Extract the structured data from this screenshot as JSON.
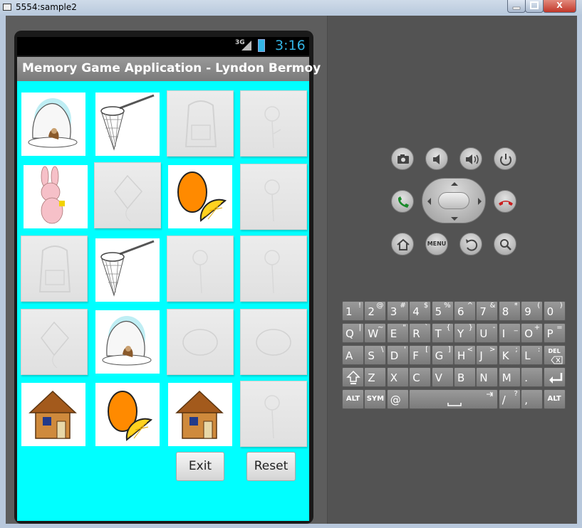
{
  "window": {
    "title": "5554:sample2",
    "close_glyph": "X"
  },
  "status": {
    "network": "3G",
    "time": "3:16"
  },
  "app": {
    "title": "Memory Game Application - Lyndon Bermoy"
  },
  "buttons": {
    "exit": "Exit",
    "reset": "Reset"
  },
  "hardware": {
    "menu": "MENU"
  },
  "cards": [
    {
      "state": "face-up",
      "image": "igloo"
    },
    {
      "state": "face-up",
      "image": "butterfly-net"
    },
    {
      "state": "face-down",
      "image": "backpack"
    },
    {
      "state": "face-down",
      "image": "flower"
    },
    {
      "state": "face-up",
      "image": "bunny"
    },
    {
      "state": "face-down",
      "image": "kite"
    },
    {
      "state": "face-up",
      "image": "orange"
    },
    {
      "state": "face-down",
      "image": "flower"
    },
    {
      "state": "face-down",
      "image": "backpack"
    },
    {
      "state": "face-up",
      "image": "butterfly-net"
    },
    {
      "state": "face-down",
      "image": "flower"
    },
    {
      "state": "face-down",
      "image": "flower"
    },
    {
      "state": "face-down",
      "image": "kite"
    },
    {
      "state": "face-up",
      "image": "igloo"
    },
    {
      "state": "face-down",
      "image": "turtle"
    },
    {
      "state": "face-down",
      "image": "turtle"
    },
    {
      "state": "face-up",
      "image": "house"
    },
    {
      "state": "face-up",
      "image": "orange"
    },
    {
      "state": "face-up",
      "image": "house"
    },
    {
      "state": "face-down",
      "image": "flower"
    }
  ],
  "keyboard": {
    "row1": [
      [
        "1",
        "!"
      ],
      [
        "2",
        "@"
      ],
      [
        "3",
        "#"
      ],
      [
        "4",
        "$"
      ],
      [
        "5",
        "%"
      ],
      [
        "6",
        "^"
      ],
      [
        "7",
        "&"
      ],
      [
        "8",
        "*"
      ],
      [
        "9",
        "("
      ],
      [
        "0",
        ")"
      ]
    ],
    "row2": [
      [
        "Q",
        "|"
      ],
      [
        "W",
        "~"
      ],
      [
        "E",
        "\""
      ],
      [
        "R",
        "`"
      ],
      [
        "T",
        "{"
      ],
      [
        "Y",
        "}"
      ],
      [
        "U",
        "-"
      ],
      [
        "I",
        "_"
      ],
      [
        "O",
        "+"
      ],
      [
        "P",
        "="
      ]
    ],
    "row3": [
      [
        "A",
        ""
      ],
      [
        "S",
        "\\"
      ],
      [
        "D",
        "'"
      ],
      [
        "F",
        "["
      ],
      [
        "G",
        "]"
      ],
      [
        "H",
        "<"
      ],
      [
        "J",
        ">"
      ],
      [
        "K",
        ";"
      ],
      [
        "L",
        ":"
      ]
    ],
    "row3_del": "DEL",
    "row4": [
      [
        "Z",
        ""
      ],
      [
        "X",
        ""
      ],
      [
        "C",
        ""
      ],
      [
        "V",
        ""
      ],
      [
        "B",
        ""
      ],
      [
        "N",
        ""
      ],
      [
        "M",
        ""
      ],
      [
        ".",
        ""
      ]
    ],
    "row5_alt": "ALT",
    "row5_sym": "SYM",
    "row5_at": "@",
    "row5_slash": "/",
    "row5_slash_sub": "?",
    "row5_comma": ","
  }
}
